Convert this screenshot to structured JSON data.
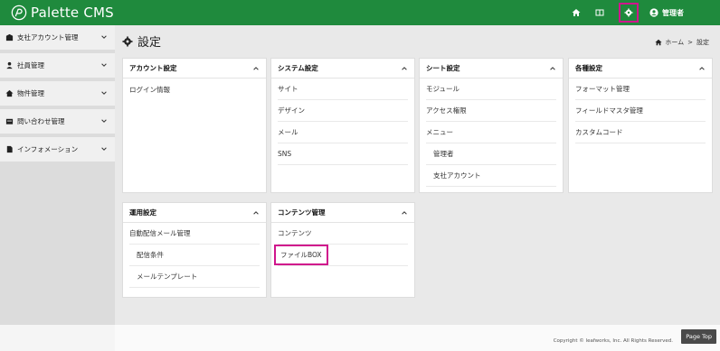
{
  "header": {
    "logo_text": "Palette CMS",
    "icons": [
      "home-icon",
      "book-icon",
      "gear-icon",
      "user-icon"
    ],
    "user_label": "管理者",
    "brand_color": "#1f8a3d",
    "highlight_color": "#d0158c"
  },
  "sidebar": {
    "items": [
      {
        "label": "支社アカウント管理",
        "icon": "building-icon"
      },
      {
        "label": "社員管理",
        "icon": "person-icon"
      },
      {
        "label": "物件管理",
        "icon": "house-icon"
      },
      {
        "label": "問い合わせ管理",
        "icon": "inbox-icon"
      },
      {
        "label": "インフォメーション",
        "icon": "document-icon"
      }
    ]
  },
  "page": {
    "title": "設定",
    "breadcrumb": {
      "home": "ホーム",
      "separator": ">",
      "current": "設定"
    }
  },
  "cards": {
    "account": {
      "title": "アカウント設定",
      "links": [
        "ログイン情報"
      ]
    },
    "system": {
      "title": "システム設定",
      "links": [
        "サイト",
        "デザイン",
        "メール",
        "SNS"
      ]
    },
    "sheet": {
      "title": "シート設定",
      "links": [
        "モジュール",
        "アクセス権限",
        "メニュー",
        "管理者",
        "支社アカウント"
      ]
    },
    "misc": {
      "title": "各種設定",
      "links": [
        "フォーマット管理",
        "フィールドマスタ管理",
        "カスタムコード"
      ]
    },
    "operation": {
      "title": "運用設定",
      "links": [
        "自動配信メール管理",
        "配信条件",
        "メールテンプレート"
      ]
    },
    "contents": {
      "title": "コンテンツ管理",
      "links": [
        "コンテンツ",
        "ファイルBOX"
      ]
    }
  },
  "footer": {
    "copyright": "Copyright © leafworks, Inc. All Rights Reserved.",
    "page_top": "Page Top"
  }
}
